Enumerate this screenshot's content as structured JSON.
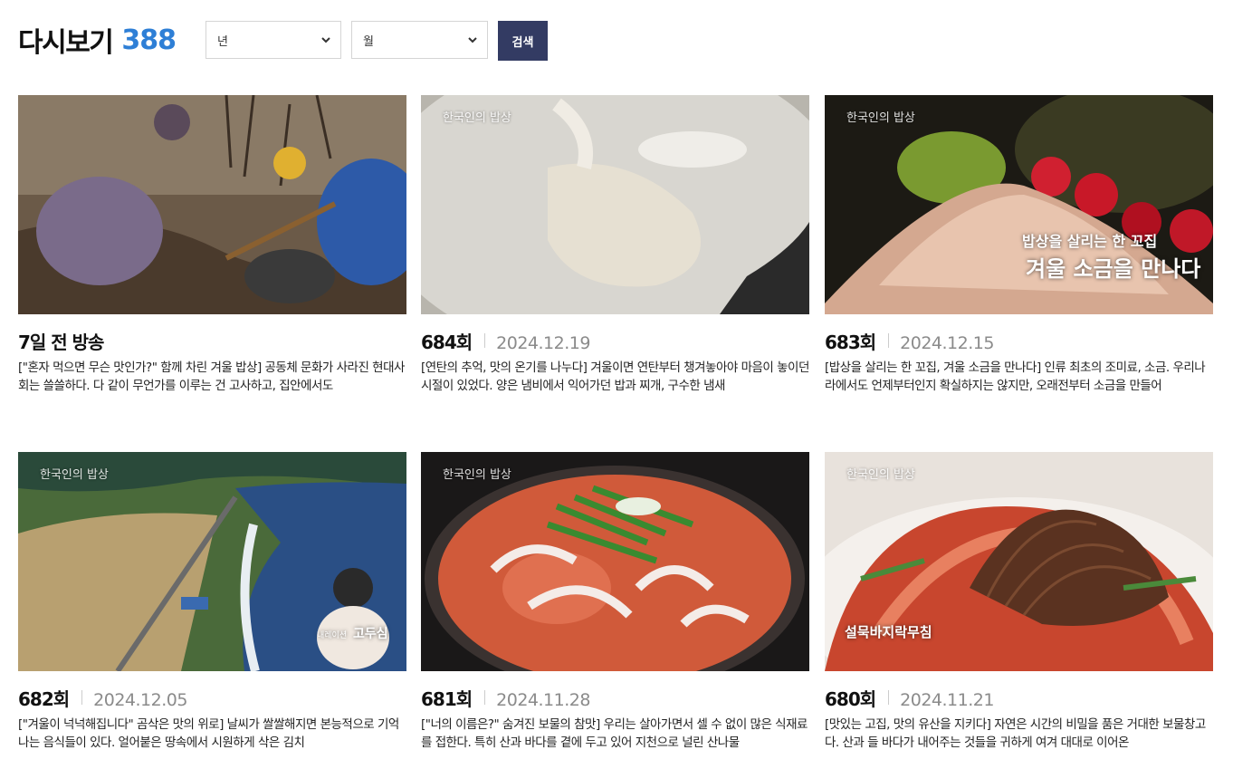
{
  "header": {
    "title": "다시보기",
    "count": "388",
    "year_select": "년",
    "month_select": "월",
    "search_label": "검색"
  },
  "colors": {
    "accent": "#2e7fd6",
    "button": "#333b63"
  },
  "items": [
    {
      "episode": "7일 전 방송",
      "date": "",
      "desc": "[\"혼자 먹으면 무슨 맛인가?\" 함께 차린 겨울 밥상] 공동체 문화가 사라진 현대사회는 쓸쓸하다. 다 같이 무언가를 이루는 건 고사하고, 집안에서도"
    },
    {
      "episode": "684회",
      "date": "2024.12.19",
      "desc": "[연탄의 추억, 맛의 온기를 나누다] 겨울이면 연탄부터 챙겨놓아야 마음이 놓이던 시절이 있었다. 양은 냄비에서 익어가던 밥과 찌개, 구수한 냄새"
    },
    {
      "episode": "683회",
      "date": "2024.12.15",
      "desc": "[밥상을 살리는 한 꼬집, 겨울 소금을 만나다] 인류 최초의 조미료, 소금. 우리나라에서도 언제부터인지 확실하지는 않지만, 오래전부터 소금을 만들어"
    },
    {
      "episode": "682회",
      "date": "2024.12.05",
      "desc": "[\"겨울이 넉넉해집니다\" 곰삭은 맛의 위로] 날씨가 쌀쌀해지면 본능적으로 기억나는 음식들이 있다. 얼어붙은 땅속에서 시원하게 삭은 김치"
    },
    {
      "episode": "681회",
      "date": "2024.11.28",
      "desc": "[\"너의 이름은?\" 숨겨진 보물의 참맛] 우리는 살아가면서 셀 수 없이 많은 식재료를 접한다. 특히 산과 바다를 곁에 두고 있어 지천으로 널린 산나물"
    },
    {
      "episode": "680회",
      "date": "2024.11.21",
      "desc": "[맛있는 고집, 맛의 유산을 지키다] 자연은 시간의 비밀을 품은 거대한 보물창고다. 산과 들 바다가 내어주는 것들을 귀하게 여겨 대대로 이어온"
    }
  ],
  "thumb_text": {
    "logo": "한국인의 밥상",
    "salt_line1": "밥상을 살리는 한 꼬집",
    "salt_line2": "겨울 소금을 만나다",
    "narrator_role": "내레이션",
    "narrator_name": "고두심",
    "dish_caption": "설묵바지락무침"
  }
}
